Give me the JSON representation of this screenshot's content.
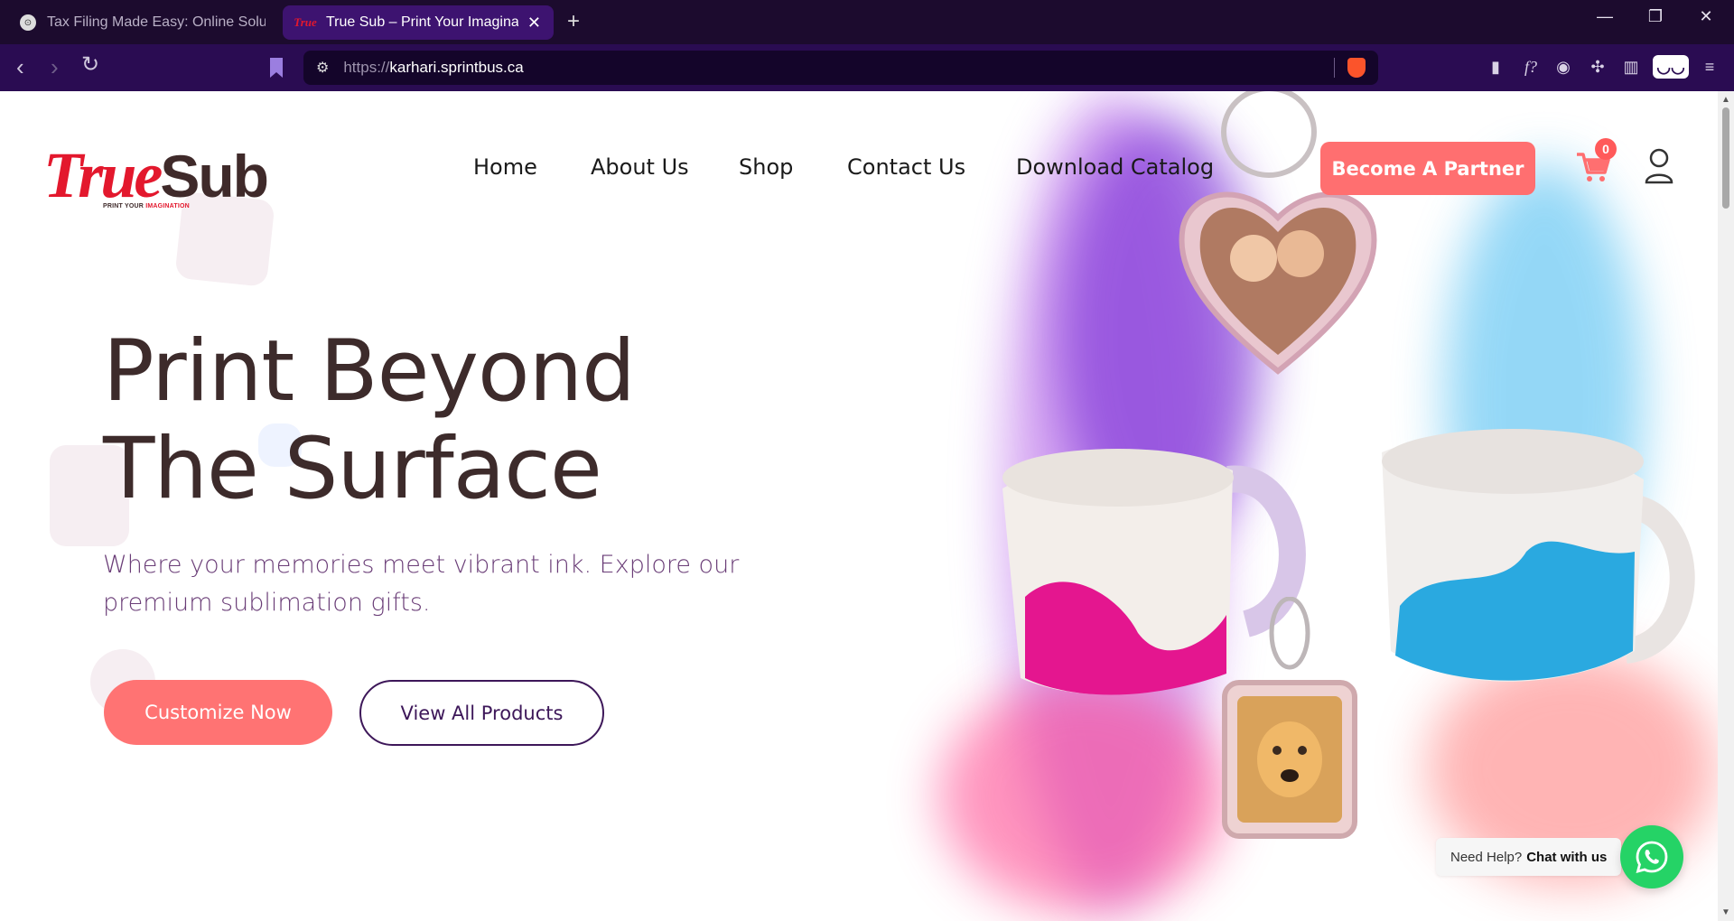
{
  "browser": {
    "tabs": [
      {
        "title": "Tax Filing Made Easy: Online Solution",
        "active": false
      },
      {
        "title": "True Sub – Print Your Imagination",
        "active": true
      }
    ],
    "url_scheme": "https://",
    "url_host": "karhari.sprintbus.ca"
  },
  "site": {
    "logo": {
      "word1": "True",
      "word2": "Sub",
      "tagline_a": "PRINT YOUR",
      "tagline_b": "IMAGINATION"
    },
    "nav": [
      "Home",
      "About Us",
      "Shop",
      "Contact Us",
      "Download Catalog"
    ],
    "partner_label": "Become A Partner",
    "cart_count": "0"
  },
  "hero": {
    "title_line1": "Print Beyond",
    "title_line2": "The Surface",
    "subtitle": "Where your memories meet vibrant ink. Explore our premium sublimation gifts.",
    "primary_button": "Customize Now",
    "secondary_button": "View All Products"
  },
  "chat": {
    "prompt": "Need Help?",
    "action": "Chat with us"
  },
  "colors": {
    "accent": "#ff6f70",
    "brand_red": "#e3182d",
    "heading": "#3d2b2b",
    "subtitle": "#6a3d77",
    "chrome": "#2a0c52"
  }
}
